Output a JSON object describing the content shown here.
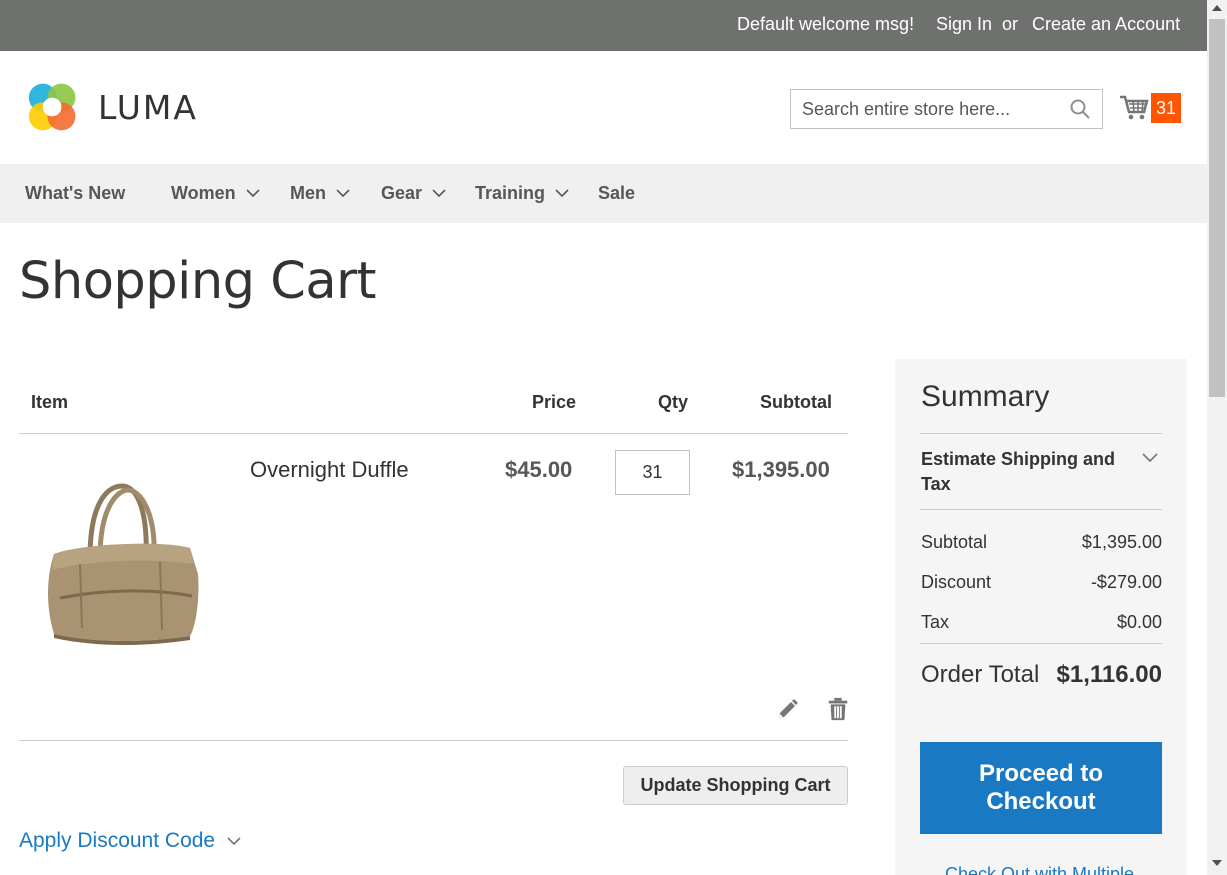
{
  "topbar": {
    "welcome": "Default welcome msg!",
    "sign_in": "Sign In",
    "or": "or",
    "create_account": "Create an Account"
  },
  "header": {
    "logo_text": "LUMA",
    "search_placeholder": "Search entire store here...",
    "cart_count": "31"
  },
  "nav": {
    "items": [
      {
        "label": "What's New",
        "has_dropdown": false
      },
      {
        "label": "Women",
        "has_dropdown": true
      },
      {
        "label": "Men",
        "has_dropdown": true
      },
      {
        "label": "Gear",
        "has_dropdown": true
      },
      {
        "label": "Training",
        "has_dropdown": true
      },
      {
        "label": "Sale",
        "has_dropdown": false
      }
    ]
  },
  "page": {
    "title": "Shopping Cart"
  },
  "cart": {
    "columns": [
      "Item",
      "Price",
      "Qty",
      "Subtotal"
    ],
    "items": [
      {
        "name": "Overnight Duffle",
        "price": "$45.00",
        "qty": "31",
        "subtotal": "$1,395.00"
      }
    ],
    "update_button": "Update Shopping Cart",
    "apply_discount": "Apply Discount Code"
  },
  "summary": {
    "title": "Summary",
    "estimate_shipping": "Estimate Shipping and Tax",
    "rows": [
      {
        "label": "Subtotal",
        "value": "$1,395.00"
      },
      {
        "label": "Discount",
        "value": "-$279.00"
      },
      {
        "label": "Tax",
        "value": "$0.00"
      }
    ],
    "order_total_label": "Order Total",
    "order_total_value": "$1,116.00",
    "checkout_button": "Proceed to Checkout",
    "multi_address": "Check Out with Multiple"
  },
  "colors": {
    "topbar_bg": "#6e716e",
    "link": "#1979c3",
    "cart_badge": "#ff5501",
    "nav_bg": "#f0f0f0"
  }
}
